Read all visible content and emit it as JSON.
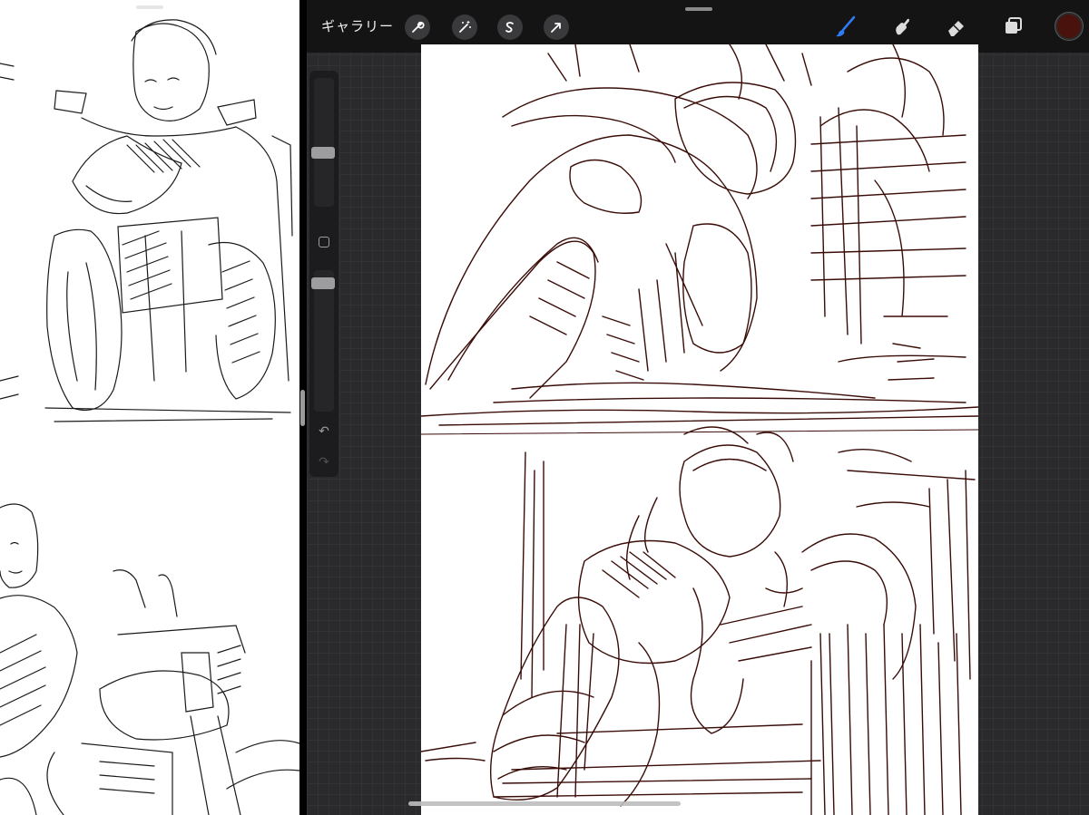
{
  "toolbar": {
    "gallery_label": "ギャラリー",
    "left_tools": [
      "wrench-icon",
      "magic-wand-icon",
      "selection-s-icon",
      "transform-arrow-icon"
    ],
    "right_tools": [
      "brush-icon",
      "smudge-icon",
      "eraser-icon",
      "layers-icon"
    ],
    "active_tool": "brush-icon",
    "current_color": "#4a120c",
    "active_tool_color": "#2f7cf6"
  },
  "sidebar": {
    "controls": [
      "brush-size-slider",
      "modify-button",
      "opacity-slider",
      "undo-icon",
      "redo-icon"
    ],
    "undo_symbol": "↶",
    "redo_symbol": "↷"
  },
  "canvas": {
    "paper_color": "#ffffff",
    "stroke_color": "#3a0c08",
    "panels": [
      "top-panel-sketch",
      "bottom-panel-sketch"
    ]
  },
  "reference_pane": {
    "content": [
      "motorcycle-rider-front-sketch",
      "rider-standing-by-motorcycle-sketch"
    ]
  }
}
